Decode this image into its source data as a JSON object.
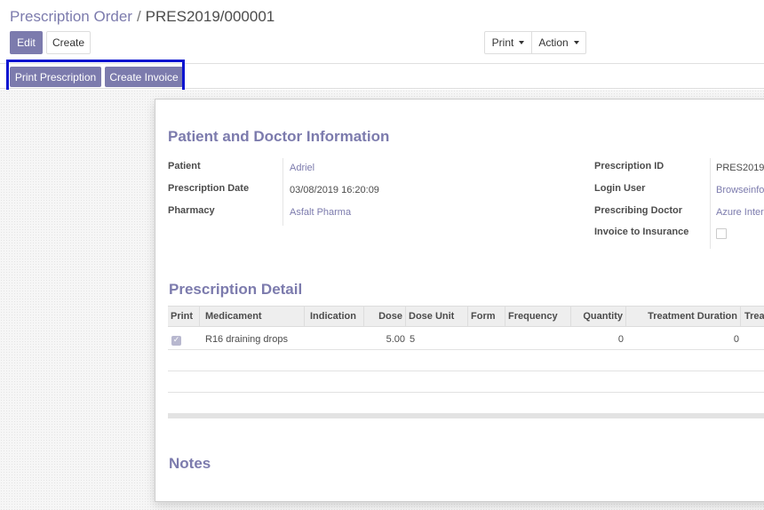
{
  "breadcrumb": {
    "parent": "Prescription Order",
    "separator": "/",
    "current": "PRES2019/000001"
  },
  "toolbar": {
    "edit_label": "Edit",
    "create_label": "Create",
    "print_label": "Print",
    "action_label": "Action"
  },
  "header_buttons": {
    "print_prescription": "Print Prescription",
    "create_invoice": "Create Invoice"
  },
  "colors": {
    "brand": "#7c7bad",
    "highlight": "#0a14d0"
  },
  "info": {
    "title": "Patient and Doctor Information",
    "left": [
      {
        "label": "Patient",
        "value": "Adriel"
      },
      {
        "label": "Prescription Date",
        "value": "03/08/2019 16:20:09"
      },
      {
        "label": "Pharmacy",
        "value": "Asfalt Pharma"
      }
    ],
    "right": [
      {
        "label": "Prescription ID",
        "value": "PRES2019"
      },
      {
        "label": "Login User",
        "value": "Browseinfo"
      },
      {
        "label": "Prescribing Doctor",
        "value": "Azure Inter"
      },
      {
        "label": "Invoice to Insurance",
        "value": ""
      }
    ]
  },
  "detail": {
    "title": "Prescription Detail",
    "columns": [
      "Print",
      "Medicament",
      "Indication",
      "Dose",
      "Dose Unit",
      "Form",
      "Frequency",
      "Quantity",
      "Treatment Duration",
      "Trea"
    ],
    "rows": [
      {
        "print": true,
        "medicament": "R16 draining drops",
        "indication": "",
        "dose": "5.00",
        "dose_unit": "5",
        "form": "",
        "frequency": "",
        "quantity": "0",
        "treatment_duration": "0"
      }
    ]
  },
  "notes": {
    "title": "Notes"
  }
}
